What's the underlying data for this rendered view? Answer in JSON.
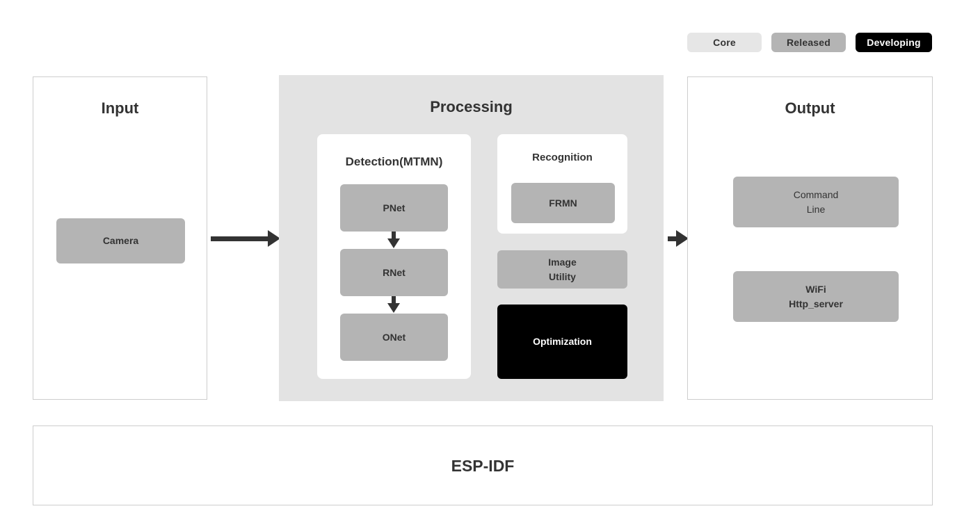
{
  "legend": {
    "items": [
      {
        "label": "Core",
        "color": "#e6e6e6",
        "text_color": "#333333"
      },
      {
        "label": "Released",
        "color": "#b4b4b4",
        "text_color": "#333333"
      },
      {
        "label": "Developing",
        "color": "#000000",
        "text_color": "#ffffff"
      }
    ]
  },
  "input": {
    "title": "Input",
    "nodes": [
      {
        "label": "Camera",
        "status": "Released"
      }
    ]
  },
  "processing": {
    "title": "Processing",
    "detection": {
      "title": "Detection(MTMN)",
      "nodes": [
        {
          "label": "PNet",
          "status": "Released"
        },
        {
          "label": "RNet",
          "status": "Released"
        },
        {
          "label": "ONet",
          "status": "Released"
        }
      ]
    },
    "recognition": {
      "title": "Recognition",
      "nodes": [
        {
          "label": "FRMN",
          "status": "Released"
        }
      ]
    },
    "extra_nodes": [
      {
        "label": "Image\nUtility",
        "status": "Released"
      },
      {
        "label": "Optimization",
        "status": "Developing"
      }
    ]
  },
  "output": {
    "title": "Output",
    "nodes": [
      {
        "label": "Command\nLine",
        "status": "Released"
      },
      {
        "label": "WiFi\nHttp_server",
        "status": "Released"
      }
    ]
  },
  "foundation": {
    "title": "ESP-IDF"
  },
  "arrows": [
    {
      "name": "input-to-processing",
      "direction": "right"
    },
    {
      "name": "processing-to-output",
      "direction": "right"
    },
    {
      "name": "pnet-to-rnet",
      "direction": "down"
    },
    {
      "name": "rnet-to-onet",
      "direction": "down"
    }
  ],
  "colors": {
    "core": "#e6e6e6",
    "released": "#b4b4b4",
    "developing": "#000000",
    "panel_bg": "#e3e3e3",
    "panel_border": "#cdcdcd",
    "text": "#333333",
    "arrow": "#333333"
  }
}
